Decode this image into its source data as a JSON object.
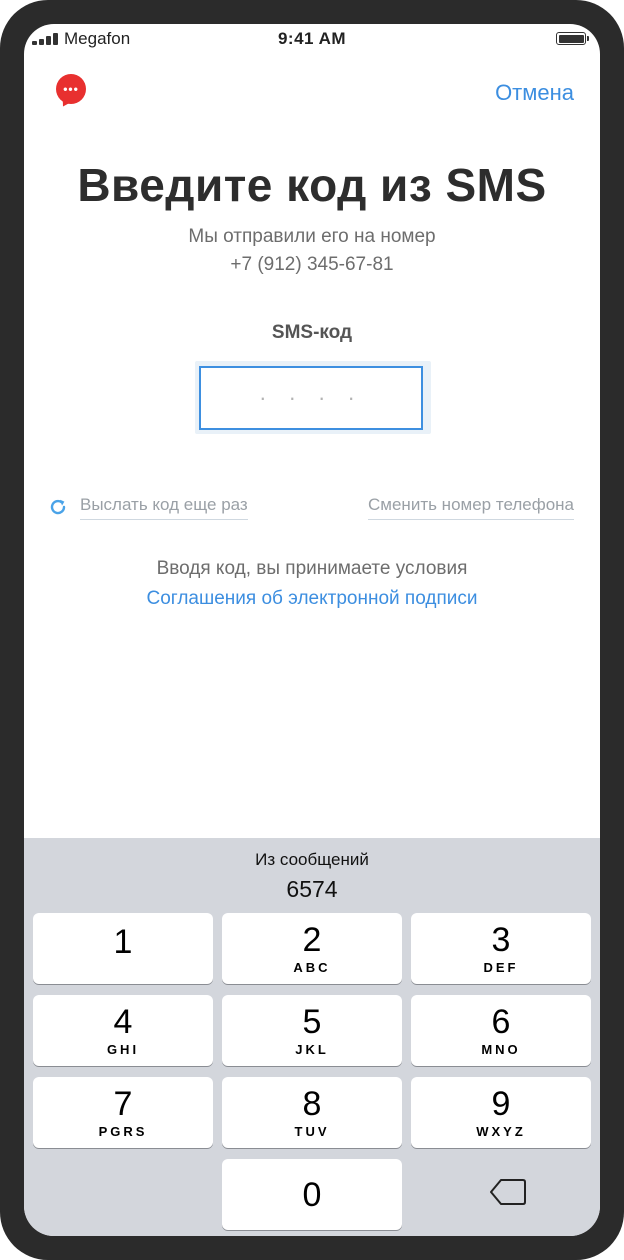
{
  "status_bar": {
    "carrier": "Megafon",
    "time": "9:41 AM"
  },
  "header": {
    "cancel_label": "Отмена"
  },
  "main": {
    "title": "Введите код из SMS",
    "subtitle_line1": "Мы отправили его на номер",
    "phone_number": "+7 (912) 345-67-81",
    "code_label": "SMS-код",
    "code_placeholder": "· · · ·",
    "resend_label": "Выслать код еще раз",
    "change_number_label": "Сменить номер телефона",
    "terms_text": "Вводя код, вы принимаете условия",
    "terms_link": "Соглашения об электронной подписи"
  },
  "keyboard": {
    "suggestion_label": "Из сообщений",
    "suggestion_code": "6574",
    "keys": [
      {
        "digit": "1",
        "letters": ""
      },
      {
        "digit": "2",
        "letters": "ABC"
      },
      {
        "digit": "3",
        "letters": "DEF"
      },
      {
        "digit": "4",
        "letters": "GHI"
      },
      {
        "digit": "5",
        "letters": "JKL"
      },
      {
        "digit": "6",
        "letters": "MNO"
      },
      {
        "digit": "7",
        "letters": "PGRS"
      },
      {
        "digit": "8",
        "letters": "TUV"
      },
      {
        "digit": "9",
        "letters": "WXYZ"
      },
      {
        "digit": "0",
        "letters": ""
      }
    ]
  },
  "colors": {
    "accent": "#3c8ee0",
    "brand_red": "#e8302f",
    "keyboard_bg": "#d3d6dc"
  },
  "icons": {
    "app": "chat-bubble-icon",
    "resend": "refresh-icon",
    "delete": "backspace-icon"
  }
}
